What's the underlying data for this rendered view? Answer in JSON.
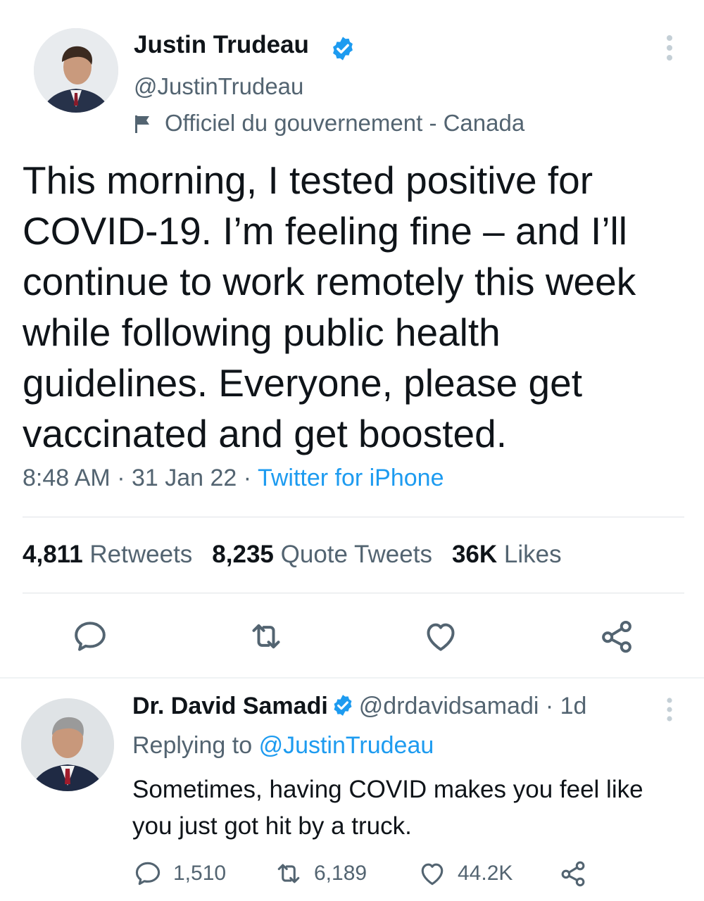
{
  "tweet": {
    "author_name": "Justin Trudeau",
    "author_handle": "@JustinTrudeau",
    "author_label": "Officiel du gouvernement - Canada",
    "text": "This morning, I tested positive for COVID-19. I’m feeling fine – and I’ll continue to work remotely this week while following public health guidelines. Everyone, please get vaccinated and get boosted.",
    "time": "8:48 AM",
    "date": "31 Jan 22",
    "separator": " · ",
    "source": "Twitter for iPhone",
    "stats": {
      "retweets_count": "4,811",
      "retweets_label": "Retweets",
      "quotes_count": "8,235",
      "quotes_label": "Quote Tweets",
      "likes_count": "36K",
      "likes_label": "Likes"
    }
  },
  "reply": {
    "author_name": "Dr. David Samadi",
    "author_handle": "@drdavidsamadi",
    "age": "· 1d",
    "replying_prefix": "Replying to",
    "replying_to": "@JustinTrudeau",
    "text": "Sometimes, having COVID makes you feel like you just got hit by a truck.",
    "reply_count": "1,510",
    "retweet_count": "6,189",
    "like_count": "44.2K"
  },
  "colors": {
    "accent": "#1d9bf0",
    "text": "#0f1419",
    "secondary": "#536471",
    "divider": "#dfe3e6"
  }
}
